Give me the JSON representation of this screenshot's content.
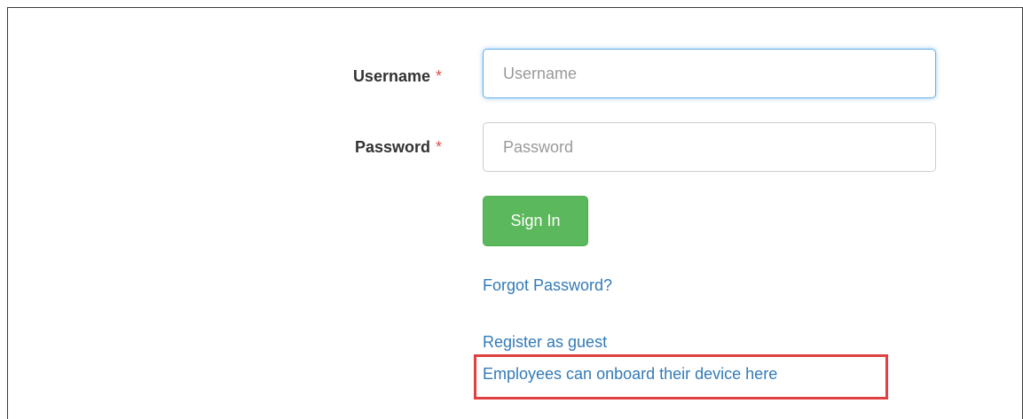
{
  "form": {
    "username": {
      "label": "Username",
      "required_marker": "*",
      "placeholder": "Username",
      "value": ""
    },
    "password": {
      "label": "Password",
      "required_marker": "*",
      "placeholder": "Password",
      "value": ""
    },
    "signin_label": "Sign In",
    "signin_color": "#5cb85c"
  },
  "links": {
    "forgot_password": "Forgot Password?",
    "register_guest": "Register as guest",
    "employee_onboard": "Employees can onboard their device here",
    "link_color": "#337ab7"
  },
  "annotation": {
    "highlight_color": "#e0403f"
  }
}
